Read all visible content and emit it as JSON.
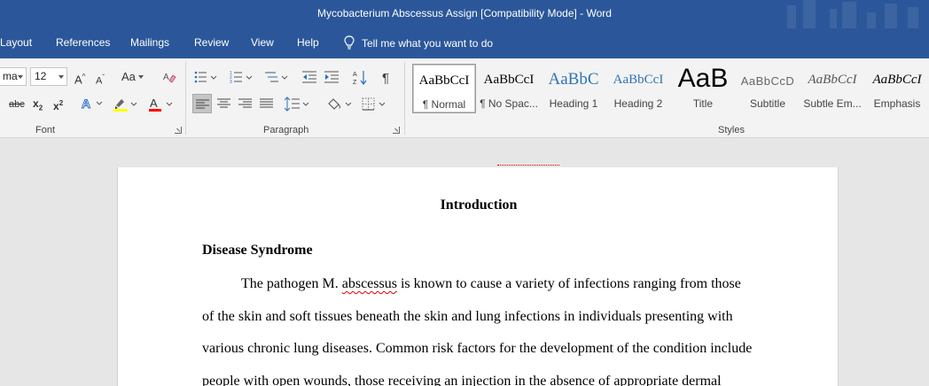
{
  "window": {
    "title": "Mycobacterium Abscessus Assign [Compatibility Mode]  -  Word"
  },
  "menu": {
    "items": [
      "Layout",
      "References",
      "Mailings",
      "Review",
      "View",
      "Help"
    ],
    "tell_me": "Tell me what you want to do"
  },
  "ribbon": {
    "font": {
      "name_value": "ma",
      "size_value": "12",
      "grow_label": "A",
      "shrink_label": "A",
      "case_label": "Aa",
      "strike_label": "abc",
      "subscript_label": "x",
      "superscript_label": "x",
      "group_label": "Font",
      "highlight_color": "#ffff00",
      "font_color": "#ff0000"
    },
    "paragraph": {
      "group_label": "Paragraph"
    },
    "styles": {
      "group_label": "Styles",
      "items": [
        {
          "preview": "AaBbCcI",
          "name": "¶ Normal"
        },
        {
          "preview": "AaBbCcI",
          "name": "¶ No Spac..."
        },
        {
          "preview": "AaBbC",
          "name": "Heading 1"
        },
        {
          "preview": "AaBbCcI",
          "name": "Heading 2"
        },
        {
          "preview": "AaB",
          "name": "Title"
        },
        {
          "preview": "AaBbCcD",
          "name": "Subtitle"
        },
        {
          "preview": "AaBbCcI",
          "name": "Subtle Em..."
        },
        {
          "preview": "AaBbCcI",
          "name": "Emphasis"
        }
      ]
    }
  },
  "document": {
    "heading": "Introduction",
    "subheading": "Disease Syndrome",
    "lines": [
      {
        "before": "The pathogen M. ",
        "misspelled": "abscessus",
        "after": " is known to cause a variety of infections ranging from those"
      },
      {
        "before": "of the skin and soft tissues beneath the skin and lung infections in individuals presenting with",
        "misspelled": "",
        "after": ""
      },
      {
        "before": "various chronic lung diseases. Common risk factors for the development of the condition include",
        "misspelled": "",
        "after": ""
      },
      {
        "before": "people with open wounds, those receiving an injection in the absence of appropriate dermal",
        "misspelled": "",
        "after": ""
      }
    ]
  },
  "colors": {
    "word_blue": "#2b579a"
  }
}
